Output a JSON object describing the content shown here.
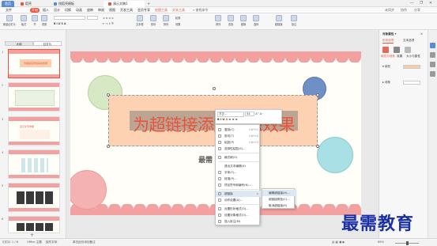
{
  "titlebar": {
    "home": "首页",
    "tabs": [
      "稻壳",
      "找稻壳模板",
      "演示文稿1"
    ],
    "new_tab": "+",
    "win_controls": [
      "—",
      "❐",
      "✕"
    ]
  },
  "menubar": {
    "file": "文件",
    "start": "开始",
    "items": [
      "插入",
      "设计",
      "切换",
      "动画",
      "放映",
      "审阅",
      "视图",
      "开发工具",
      "会员专享",
      "绘图工具",
      "文本工具"
    ],
    "search": "查找命令",
    "right": [
      "未同步",
      "协作",
      "分享"
    ]
  },
  "ribbon": {
    "buttons": [
      "新建幻灯片",
      "版式",
      "节",
      "重置",
      "字体",
      "段落",
      "文本框",
      "形状",
      "排列",
      "查找",
      "替换",
      "选择"
    ],
    "small": [
      "文本框",
      "形状",
      "排列",
      "轮廓",
      "效果",
      "替换"
    ],
    "right_buttons": [
      "排列",
      "查找",
      "替换",
      "选择",
      "超链接",
      "批注"
    ]
  },
  "left_panel": {
    "tabs": [
      "大纲",
      "幻灯片"
    ],
    "slide_numbers": [
      "1",
      "2",
      "3",
      "4",
      "5",
      "6"
    ],
    "thumb1_title": "为超链接添加动态效果",
    "thumb3_title": "显示文字效果",
    "add": "+"
  },
  "slide": {
    "title": "为超链接添加动态效果",
    "subtitle": "最需"
  },
  "mini_toolbar": {
    "font": "方正…",
    "size": "54",
    "format_labels": [
      "B",
      "I",
      "U",
      "A",
      "≡",
      "≡",
      "≡"
    ]
  },
  "context_menu": {
    "items": [
      {
        "label": "复制(C)",
        "key": "Ctrl+C"
      },
      {
        "label": "剪切(T)",
        "key": "Ctrl+X"
      },
      {
        "label": "粘贴(P)",
        "key": "Ctrl+V"
      },
      {
        "label": "选择性粘贴(S)...",
        "key": ""
      },
      {
        "label": "格式刷(O)",
        "key": ""
      },
      {
        "label": "退出文本编辑(X)",
        "key": ""
      },
      {
        "label": "字体(F)...",
        "key": ""
      },
      {
        "label": "段落(P)...",
        "key": ""
      },
      {
        "label": "项目符号和编号(N)...",
        "key": ""
      },
      {
        "label": "超链接",
        "key": "▸"
      },
      {
        "label": "动作设置(A)...",
        "key": ""
      },
      {
        "label": "设置形状格式(O)...",
        "key": ""
      },
      {
        "label": "设置对象格式(O)...",
        "key": ""
      },
      {
        "label": "插入批注(M)",
        "key": ""
      }
    ],
    "submenu": [
      "编辑超链接(H)...",
      "超链接颜色(C)...",
      "取消超链接(R)"
    ]
  },
  "right_panel": {
    "title": "对象属性 ▾",
    "tabs": [
      "形状选项",
      "文本选项"
    ],
    "subtabs": [
      "填充与线条",
      "效果",
      "大小与属性"
    ],
    "sections": [
      "填充",
      "线条"
    ]
  },
  "statusbar": {
    "slide_info": "幻灯片 1 / 6",
    "theme": "Office 主题",
    "backup": "缺失字体",
    "note": "单击此处添加备注",
    "zoom": "69%"
  },
  "watermark": "最需教育",
  "colors": {
    "accent": "#e8543b",
    "title_text": "#e8543b",
    "title_box": "#fdd2b3",
    "band": "#f2a0a0",
    "watermark": "#1a2fa8"
  }
}
